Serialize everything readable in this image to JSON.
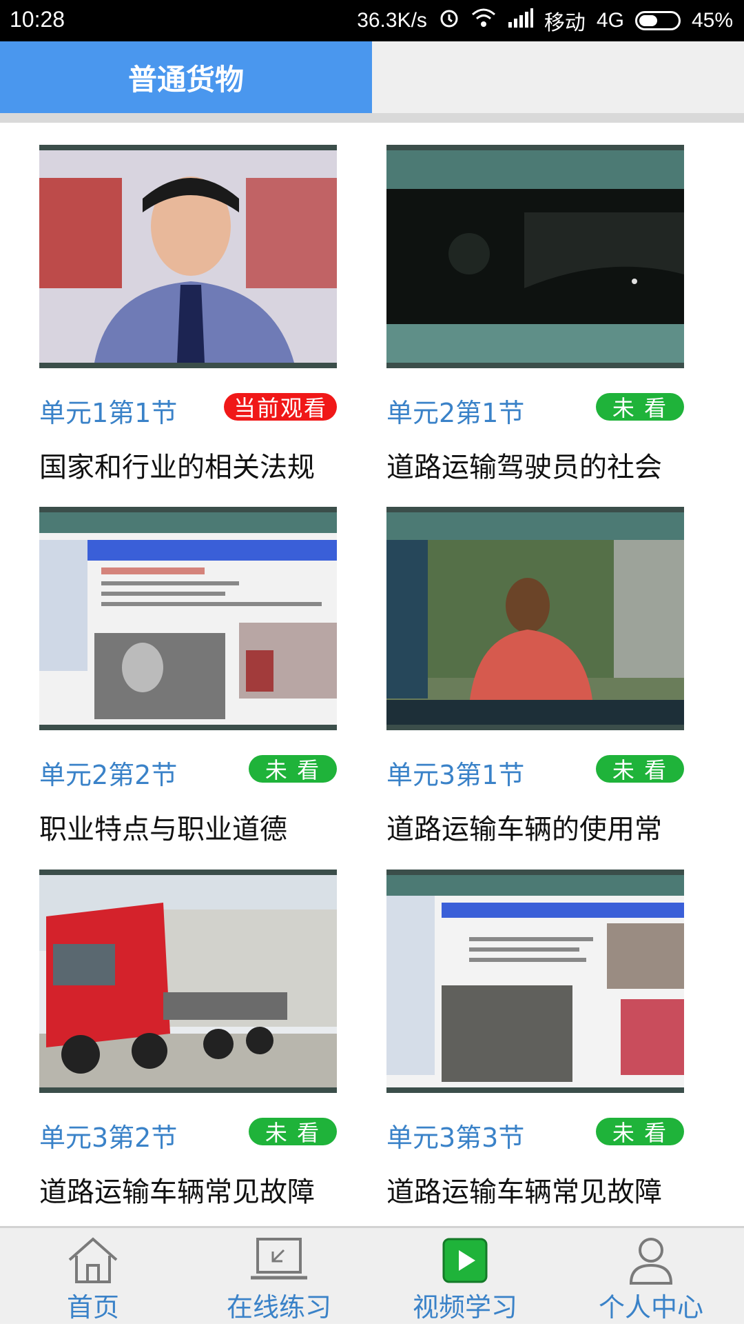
{
  "status_bar": {
    "time": "10:28",
    "speed": "36.3K/s",
    "carrier": "移动",
    "network": "4G",
    "battery": "45%"
  },
  "tabs": {
    "active_label": "普通货物"
  },
  "videos": [
    {
      "unit": "单元1第1节",
      "status": "当前观看",
      "status_type": "current",
      "title": "国家和行业的相关法规"
    },
    {
      "unit": "单元2第1节",
      "status": "未 看",
      "status_type": "unseen",
      "title": "道路运输驾驶员的社会"
    },
    {
      "unit": "单元2第2节",
      "status": "未 看",
      "status_type": "unseen",
      "title": "职业特点与职业道德"
    },
    {
      "unit": "单元3第1节",
      "status": "未 看",
      "status_type": "unseen",
      "title": "道路运输车辆的使用常"
    },
    {
      "unit": "单元3第2节",
      "status": "未 看",
      "status_type": "unseen",
      "title": "道路运输车辆常见故障"
    },
    {
      "unit": "单元3第3节",
      "status": "未 看",
      "status_type": "unseen",
      "title": "道路运输车辆常见故障"
    }
  ],
  "colors": {
    "accent": "#4a97ee",
    "link_text": "#3a82c8",
    "badge_current": "#f01818",
    "badge_unseen": "#1fb33a",
    "nav_active_icon": "#1fb33a"
  },
  "bottom_nav": {
    "items": [
      {
        "label": "首页",
        "icon": "home-icon"
      },
      {
        "label": "在线练习",
        "icon": "laptop-icon"
      },
      {
        "label": "视频学习",
        "icon": "video-play-icon"
      },
      {
        "label": "个人中心",
        "icon": "user-icon"
      }
    ]
  }
}
